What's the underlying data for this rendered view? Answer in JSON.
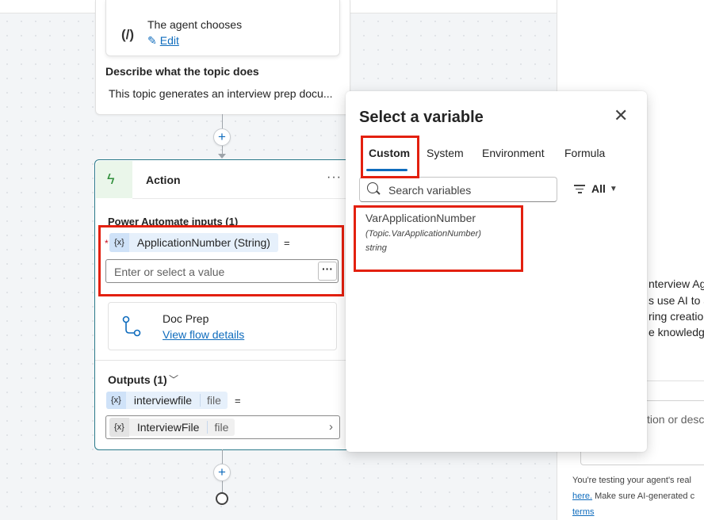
{
  "trigger": {
    "agent_title": "The agent chooses",
    "edit_label": "Edit",
    "describe_label": "Describe what the topic does",
    "describe_text": "This topic generates an interview prep docu..."
  },
  "action": {
    "title": "Action",
    "more": "···",
    "inputs_label": "Power Automate inputs (1)",
    "required_mark": "*",
    "input_var_icon": "{x}",
    "input_var_name": "ApplicationNumber (String)",
    "equals": "=",
    "value_placeholder": "Enter or select a value",
    "value_more": "···",
    "flow_name": "Doc Prep",
    "flow_link": "View flow details",
    "outputs_label": "Outputs (1)",
    "output_var_icon": "{x}",
    "output_var_name": "interviewfile",
    "output_var_type": "file",
    "output_field_icon": "{x}",
    "output_field_name": "InterviewFile",
    "output_field_type": "file"
  },
  "popup": {
    "title": "Select a variable",
    "tabs": [
      "Custom",
      "System",
      "Environment",
      "Formula"
    ],
    "active_tab": "Custom",
    "search_placeholder": "Search variables",
    "filter_label": "All",
    "variables": [
      {
        "name": "VarApplicationNumber",
        "path": "(Topic.VarApplicationNumber)",
        "type": "string"
      }
    ]
  },
  "test_panel": {
    "lines": [
      "nterview Ag",
      "s use AI to a",
      "ring creation",
      "e knowledge"
    ],
    "input_placeholder": "tion or descr",
    "footer_line1": "You're testing your agent's real",
    "footer_link": "here.",
    "footer_line2_rest": " Make sure AI-generated c",
    "footer_terms": "terms"
  },
  "colors": {
    "accent": "#0f6cbd",
    "highlight_box": "#e3200f",
    "action_border": "#2b7a8a"
  }
}
